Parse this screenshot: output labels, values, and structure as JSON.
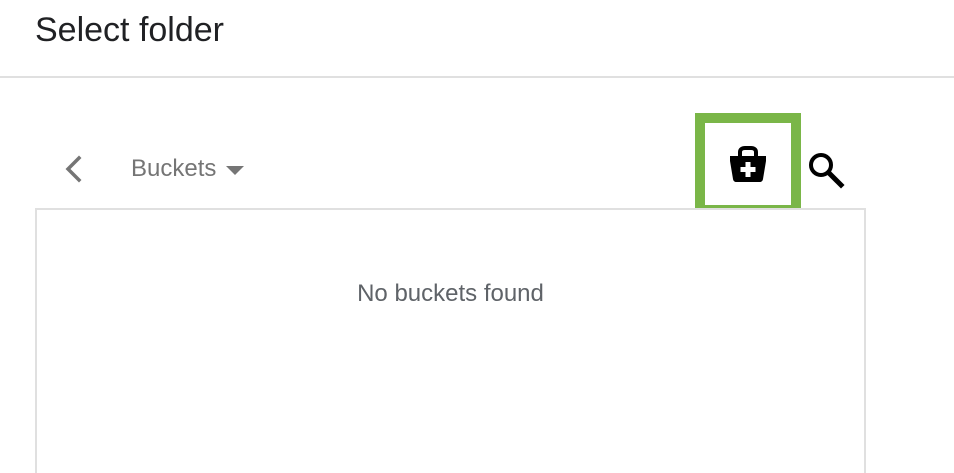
{
  "dialog": {
    "title": "Select folder"
  },
  "toolbar": {
    "back_icon": "chevron-left-icon",
    "location_label": "Buckets",
    "location_caret_icon": "triangle-down-icon",
    "create_icon": "bucket-plus-icon",
    "search_icon": "search-icon",
    "highlight_color": "#7ab648"
  },
  "bucket_list": {
    "empty_message": "No buckets found"
  }
}
